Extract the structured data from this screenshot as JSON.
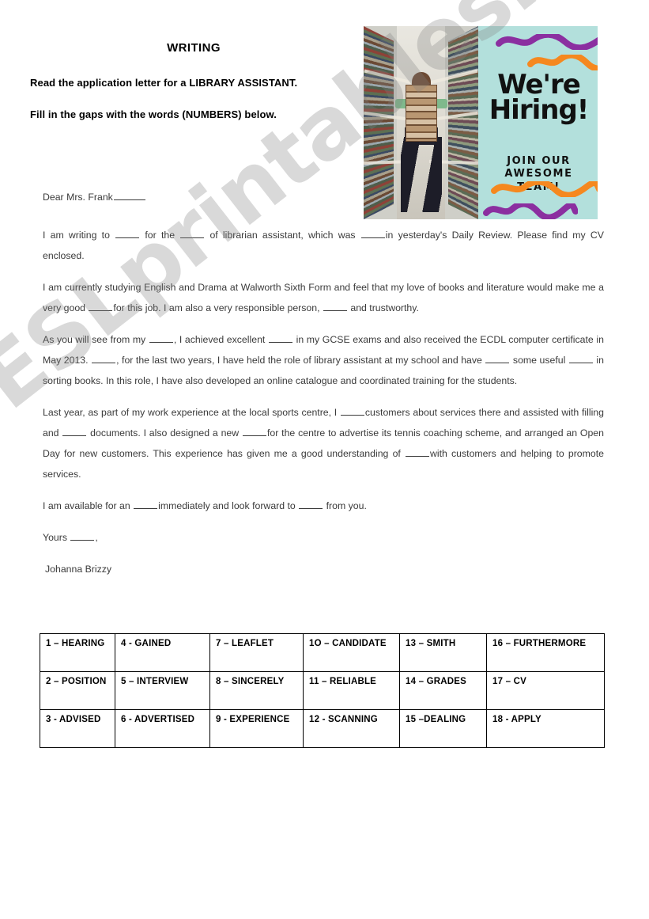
{
  "header": {
    "title": "WRITING",
    "instruction_1": "Read the application letter for a LIBRARY ASSISTANT.",
    "instruction_2": "Fill in the gaps with the words (NUMBERS) below."
  },
  "poster": {
    "headline_line1": "We're",
    "headline_line2": "Hiring!",
    "subline_1": "JOIN OUR",
    "subline_2": "AWESOME TEAM!",
    "colors": {
      "panel_bg": "#b3e0dc",
      "wave_purple": "#8b2fa0",
      "wave_orange": "#f5881f",
      "text": "#111111"
    },
    "photo_alt": "student holding stack of books between library shelves"
  },
  "letter": {
    "salutation_before": "Dear Mrs. Frank",
    "p1_a": "I am writing to ",
    "p1_b": " for the ",
    "p1_c": " of librarian assistant, which was ",
    "p1_d": "in yesterday's Daily Review. Please find my CV enclosed.",
    "p2_a": "I am currently studying English and Drama at Walworth Sixth Form and feel that my love of books and literature would make me a very good ",
    "p2_b": "for this job. I am also a very responsible person, ",
    "p2_c": " and trustworthy.",
    "p3_a": "As you will see from my ",
    "p3_b": ", I achieved excellent ",
    "p3_c": " in my GCSE exams and also received the ECDL computer certificate in May 2013. ",
    "p3_d": ", for the last two years, I have held the role of library assistant at my school and have ",
    "p3_e": " some useful ",
    "p3_f": " in sorting books. In this role, I have also developed an online catalogue and coordinated training for the students.",
    "p4_a": "Last year, as part of my work experience at the local sports centre, I ",
    "p4_b": "customers about services there and assisted with filling and ",
    "p4_c": " documents. I also designed a new ",
    "p4_d": "for the centre to advertise its tennis coaching scheme, and arranged an Open Day for new customers. This experience has given me a good understanding of ",
    "p4_e": "with customers and helping to promote services.",
    "p5_a": "I am available for an ",
    "p5_b": "immediately and look forward to ",
    "p5_c": " from you.",
    "closing_before": "Yours ",
    "closing_after": ",",
    "signature": "Johanna Brizzy"
  },
  "wordbank": {
    "rows": [
      [
        "1 – HEARING",
        "4 - GAINED",
        "7 – LEAFLET",
        "1O – CANDIDATE",
        "13 – SMITH",
        "16 – FURTHERMORE"
      ],
      [
        "2 – POSITION",
        "5 – INTERVIEW",
        "8 – SINCERELY",
        "11 – RELIABLE",
        "14 – GRADES",
        "17 – CV"
      ],
      [
        "3 - ADVISED",
        "6 - ADVERTISED",
        "9 - EXPERIENCE",
        "12 - SCANNING",
        "15 –DEALING",
        "18 - APPLY"
      ]
    ]
  },
  "watermark": {
    "text": "ESLprintables.com"
  }
}
